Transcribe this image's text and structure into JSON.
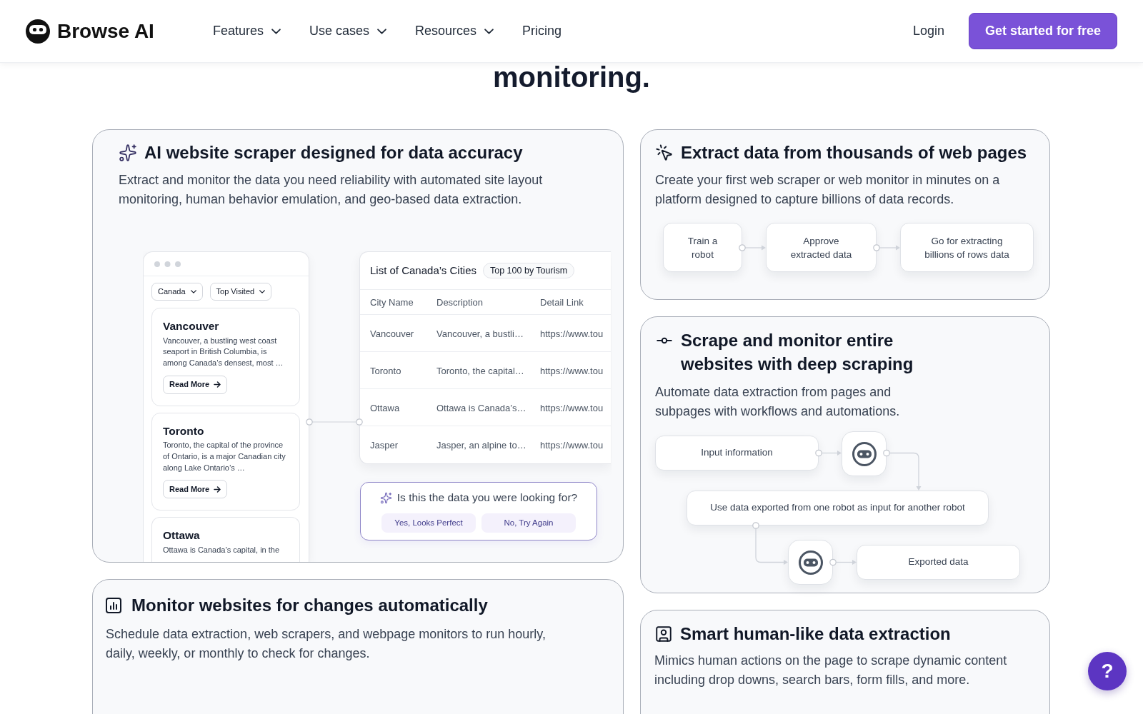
{
  "navbar": {
    "brand": "Browse AI",
    "links": [
      {
        "label": "Features",
        "dropdown": true
      },
      {
        "label": "Use cases",
        "dropdown": true
      },
      {
        "label": "Resources",
        "dropdown": true
      },
      {
        "label": "Pricing",
        "dropdown": false
      }
    ],
    "login": "Login",
    "cta": "Get started for free"
  },
  "section_heading": "monitoring.",
  "columns": [
    {
      "cards": [
        {
          "kind": "accuracy",
          "title": "AI website scraper designed for data accuracy",
          "description": "Extract and monitor the data you need reliability with automated site layout monitoring, human behavior emulation, and geo-based data extraction.",
          "demo": {
            "filters": [
              "Canada",
              "Top Visited"
            ],
            "cities": [
              {
                "name": "Vancouver",
                "description": "Vancouver, a bustling west coast seaport in British Columbia, is among Canada’s densest, most …",
                "button": "Read More"
              },
              {
                "name": "Toronto",
                "description": "Toronto, the capital of the province of Ontario, is a major Canadian city along Lake Ontario’s …",
                "button": "Read More"
              },
              {
                "name": "Ottawa",
                "description": "Ottawa is Canada’s capital, in the"
              }
            ],
            "table": {
              "title": "List of Canada’s Cities",
              "tag": "Top 100 by Tourism",
              "columns": [
                "City Name",
                "Description",
                "Detail Link"
              ],
              "rows": [
                [
                  "Vancouver",
                  "Vancouver, a bustli…",
                  "https://www.tou"
                ],
                [
                  "Toronto",
                  "Toronto, the capital…",
                  "https://www.tou"
                ],
                [
                  "Ottawa",
                  "Ottawa is Canada’s…",
                  "https://www.tou"
                ],
                [
                  "Jasper",
                  "Jasper, an alpine to…",
                  "https://www.tou"
                ]
              ]
            },
            "feedback": {
              "question": "Is this the data you were looking for?",
              "buttons": [
                "Yes, Looks Perfect",
                "No, Try Again"
              ]
            }
          }
        },
        {
          "kind": "monitor",
          "title": "Monitor websites for changes automatically",
          "description": "Schedule data extraction, web scrapers, and webpage monitors to run hourly, daily, weekly, or monthly to check for changes."
        }
      ]
    },
    {
      "cards": [
        {
          "kind": "pipeline",
          "title": "Extract data from thousands of web pages",
          "description": "Create your first web scraper or web monitor in minutes on a platform designed to capture billions of data records.",
          "steps": [
            "Train a robot",
            "Approve extracted data",
            "Go for extracting billions of rows data"
          ]
        },
        {
          "kind": "workflow",
          "title": "Scrape and monitor entire websites with deep scraping",
          "description": "Automate data extraction from pages and subpages with workflows and automations.",
          "nodes": [
            {
              "kind": "step",
              "label": "Input information"
            },
            {
              "kind": "robot"
            },
            {
              "kind": "step",
              "label": "Use data exported from one robot as input for another robot"
            },
            {
              "kind": "robot"
            },
            {
              "kind": "step",
              "label": "Exported data"
            }
          ]
        },
        {
          "kind": "human",
          "title": "Smart human-like data extraction",
          "description": "Mimics human actions on the page to scrape dynamic content including drop downs, search bars, form fills, and more."
        }
      ]
    }
  ],
  "help_button": "?"
}
